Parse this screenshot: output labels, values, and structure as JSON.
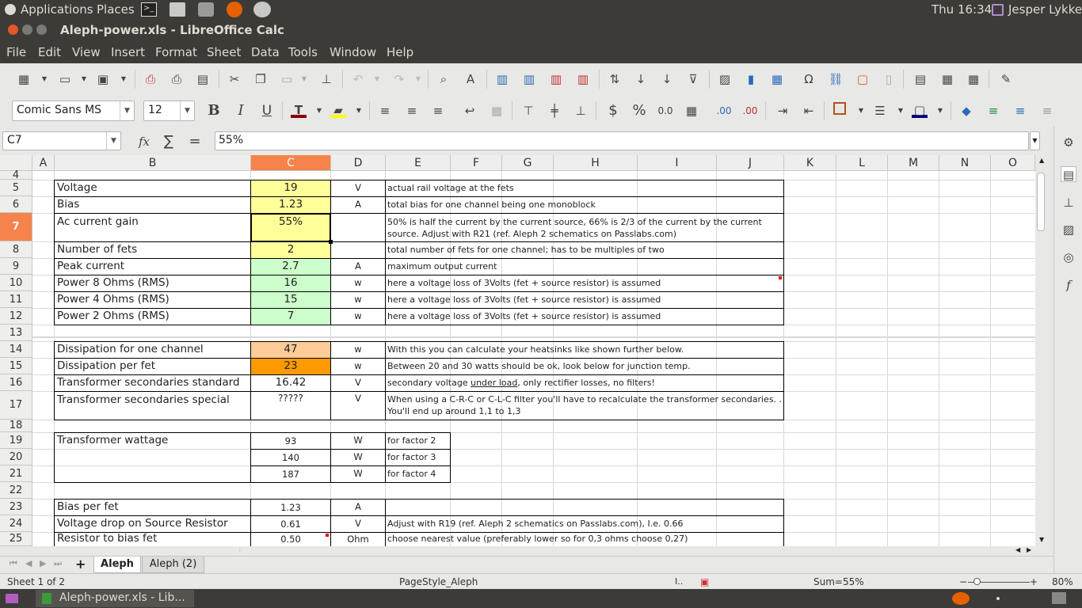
{
  "panel": {
    "applications": "Applications",
    "places": "Places",
    "clock": "Thu 16:34",
    "user": "Jesper Lykke"
  },
  "window": {
    "title": "Aleph-power.xls - LibreOffice Calc"
  },
  "menu": [
    "File",
    "Edit",
    "View",
    "Insert",
    "Format",
    "Sheet",
    "Data",
    "Tools",
    "Window",
    "Help"
  ],
  "format": {
    "font": "Comic Sans MS",
    "size": "12"
  },
  "formula": {
    "cell_ref": "C7",
    "fx": "fx",
    "sum": "∑",
    "eq": "=",
    "content": "55%"
  },
  "columns": [
    "A",
    "B",
    "C",
    "D",
    "E",
    "F",
    "G",
    "H",
    "I",
    "J",
    "K",
    "L",
    "M",
    "N",
    "O"
  ],
  "rows": {
    "r4": {
      "num": "4"
    },
    "r5": {
      "num": "5",
      "label": "Voltage",
      "value": "19",
      "unit": "V",
      "desc": "actual rail voltage at the fets"
    },
    "r6": {
      "num": "6",
      "label": "Bias",
      "value": "1.23",
      "unit": "A",
      "desc": "total bias for one channel being one monoblock"
    },
    "r7": {
      "num": "7",
      "label": "Ac current gain",
      "value": "55%",
      "unit": "",
      "desc": "50% is half the current by the current source, 66% is 2/3 of the current by the current source. Adjust with R21 (ref. Aleph 2 schematics on Passlabs.com)"
    },
    "r8": {
      "num": "8",
      "label": "Number of fets",
      "value": "2",
      "unit": "",
      "desc": "total number of fets for one channel; has to be multiples of two"
    },
    "r9": {
      "num": "9",
      "label": "Peak current",
      "value": "2.7",
      "unit": "A",
      "desc": "maximum output current"
    },
    "r10": {
      "num": "10",
      "label": "Power 8 Ohms (RMS)",
      "value": "16",
      "unit": "w",
      "desc": "here a voltage loss of 3Volts (fet + source resistor) is assumed"
    },
    "r11": {
      "num": "11",
      "label": "Power 4 Ohms (RMS)",
      "value": "15",
      "unit": "w",
      "desc": "here a voltage loss of 3Volts (fet + source resistor) is assumed"
    },
    "r12": {
      "num": "12",
      "label": "Power 2 Ohms (RMS)",
      "value": "7",
      "unit": "w",
      "desc": "here a voltage loss of 3Volts (fet + source resistor) is assumed"
    },
    "r13": {
      "num": "13"
    },
    "r14": {
      "num": "14",
      "label": "Dissipation for one channel",
      "value": "47",
      "unit": "w",
      "desc": "With this you can calculate your heatsinks like shown further below."
    },
    "r15": {
      "num": "15",
      "label": "Dissipation per fet",
      "value": "23",
      "unit": "w",
      "desc": "Between 20 and 30 watts should be ok, look below for junction temp."
    },
    "r16": {
      "num": "16",
      "label": "Transformer secondaries standard",
      "value": "16.42",
      "unit": "V",
      "desc_a": "secondary voltage ",
      "desc_b": "under load",
      "desc_c": ", only rectifier losses, no filters!"
    },
    "r17": {
      "num": "17",
      "label": "Transformer secondaries special",
      "value": "?????",
      "unit": "V",
      "desc": "When using a C-R-C or C-L-C filter you'll have to recalculate the transformer secondaries. . You'll end up around 1,1 to 1,3"
    },
    "r18": {
      "num": "18"
    },
    "r19": {
      "num": "19",
      "label": "Transformer wattage",
      "value": "93",
      "unit": "W",
      "desc": "for factor 2"
    },
    "r20": {
      "num": "20",
      "value": "140",
      "unit": "W",
      "desc": "for factor 3"
    },
    "r21": {
      "num": "21",
      "value": "187",
      "unit": "W",
      "desc": "for factor 4"
    },
    "r22": {
      "num": "22"
    },
    "r23": {
      "num": "23",
      "label": "Bias per fet",
      "value": "1.23",
      "unit": "A"
    },
    "r24": {
      "num": "24",
      "label": "Voltage drop on Source Resistor",
      "value": "0.61",
      "unit": "V",
      "desc": "Adjust with R19  (ref. Aleph 2 schematics on Passlabs.com),  I.e. 0.66"
    },
    "r25": {
      "num": "25",
      "label": "Resistor to bias fet",
      "value": "0.50",
      "unit": "Ohm",
      "desc": "choose nearest value (preferably lower so for 0,3 ohms choose 0,27)"
    }
  },
  "tabs": {
    "add": "+",
    "sheet1": "Aleph",
    "sheet2": "Aleph  (2)"
  },
  "status": {
    "sheet": "Sheet 1 of 2",
    "pagestyle": "PageStyle_Aleph",
    "sum": "Sum=55%",
    "zoom": "80%"
  },
  "taskbar": {
    "item": "Aleph-power.xls - Lib..."
  },
  "colors": {
    "yellow": "#ffff99",
    "green": "#ccffcc",
    "peach": "#ffcc99",
    "orange": "#ff9900",
    "accent": "#f5834b"
  }
}
